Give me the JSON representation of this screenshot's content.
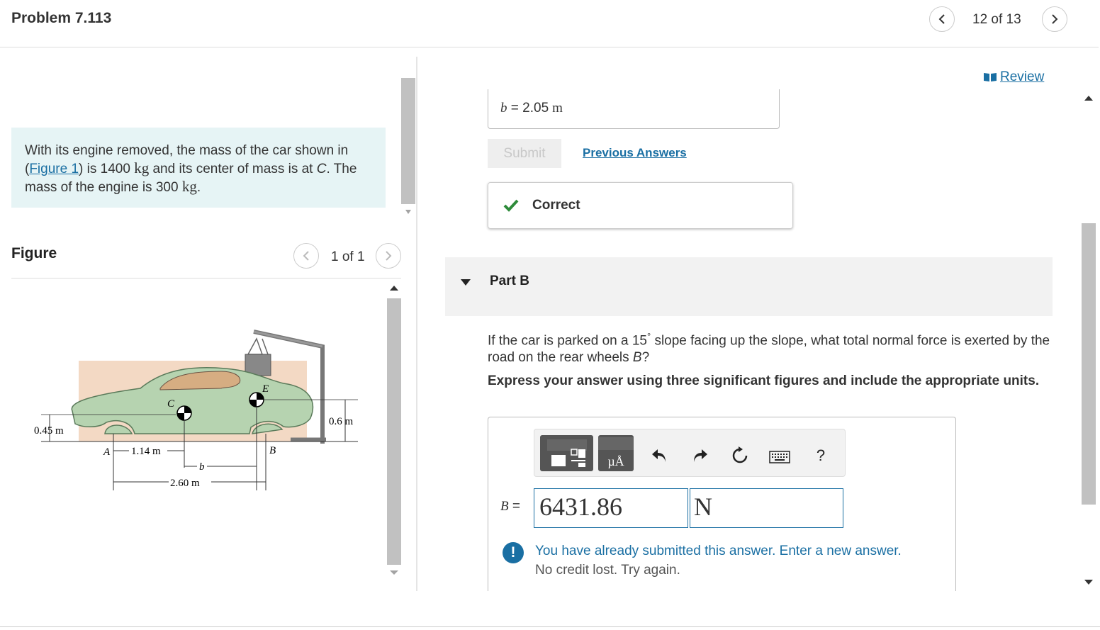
{
  "header": {
    "title": "Problem 7.113",
    "counter": "12 of 13"
  },
  "problem": {
    "text_before_link": "With its engine removed, the mass of the car shown in (",
    "link": "Figure 1",
    "text_after_link_1": ") is 1400 ",
    "unit_kg": "kg",
    "text_after_link_2": " and its center of mass is at ",
    "point_c": "C",
    "text_after_link_3": ". The mass of the engine is 300 ",
    "unit_kg_2": "kg",
    "period": "."
  },
  "figure": {
    "heading": "Figure",
    "pager": "1 of 1",
    "labels": {
      "c": "C",
      "e": "E",
      "a": "A",
      "b": "B",
      "dim_045": "0.45 m",
      "dim_06": "0.6 m",
      "dim_114": "1.14 m",
      "dim_b": "b",
      "dim_260": "2.60 m"
    }
  },
  "review": {
    "label": "Review"
  },
  "part_a": {
    "answer_var": "b",
    "answer_eq": " = ",
    "answer_value": "2.05",
    "answer_unit": "m",
    "submit": "Submit",
    "previous_answers": "Previous Answers",
    "feedback": "Correct"
  },
  "part_b": {
    "title": "Part B",
    "question_1": "If the car is parked on a 15",
    "degree": "°",
    "question_2": " slope facing up the slope, what total normal force is exerted by the road on the rear wheels ",
    "question_var": "B",
    "question_end": "?",
    "instructions": "Express your answer using three significant figures and include the appropriate units.",
    "toolbar": {
      "units_label": "µÅ",
      "help": "?"
    },
    "answer_label_var": "B",
    "answer_label_eq": " = ",
    "value": "6431.86",
    "unit": "N",
    "warning_line1": "You have already submitted this answer. Enter a new answer.",
    "warning_line2": "No credit lost. Try again."
  },
  "colors": {
    "accent": "#1a6fa3",
    "problem_bg": "#e6f4f5",
    "car_body": "#b6d3b0",
    "window": "#d6ad82",
    "backdrop": "#f3d9c4",
    "correct_green": "#2e8b3a",
    "warning_blue": "#1a6fa3"
  },
  "icons": [
    "chevron-left-icon",
    "chevron-right-icon",
    "book-icon",
    "checkmark-icon",
    "triangle-down-icon",
    "templates-icon",
    "units-icon",
    "undo-icon",
    "redo-icon",
    "reset-icon",
    "keyboard-icon",
    "help-icon",
    "exclamation-icon"
  ]
}
